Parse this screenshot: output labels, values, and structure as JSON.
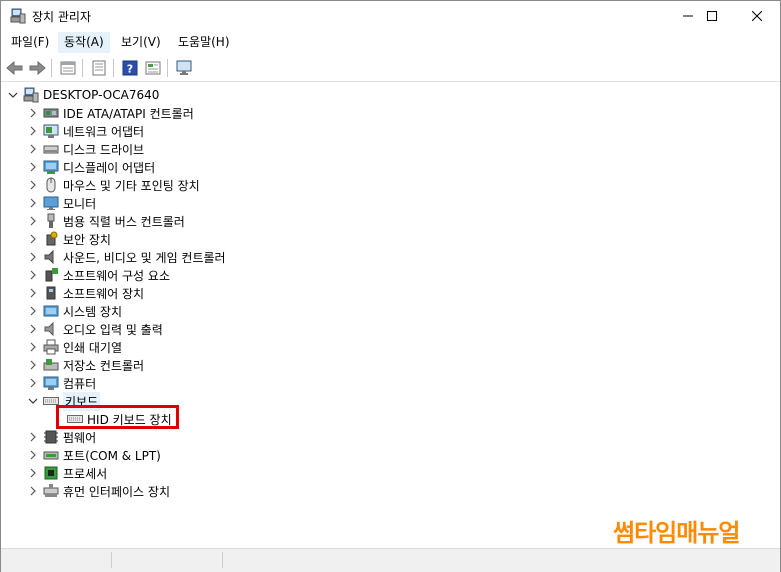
{
  "window": {
    "title": "장치 관리자",
    "icon": "device-manager-icon"
  },
  "menu": [
    {
      "label": "파일(F)"
    },
    {
      "label": "동작(A)"
    },
    {
      "label": "보기(V)"
    },
    {
      "label": "도움말(H)"
    }
  ],
  "toolbar": {
    "buttons": [
      "back-icon",
      "forward-icon",
      "properties-icon",
      "device-list-icon",
      "help-icon",
      "view-icon",
      "monitor-scan-icon"
    ]
  },
  "tree": {
    "root": {
      "label": "DESKTOP-OCA7640",
      "expanded": true
    },
    "items": [
      {
        "label": "IDE ATA/ATAPI 컨트롤러",
        "icon": "ide-controller-icon",
        "expanded": false
      },
      {
        "label": "네트워크 어댑터",
        "icon": "network-adapter-icon",
        "expanded": false
      },
      {
        "label": "디스크 드라이브",
        "icon": "disk-drive-icon",
        "expanded": false
      },
      {
        "label": "디스플레이 어댑터",
        "icon": "display-adapter-icon",
        "expanded": false
      },
      {
        "label": "마우스 및 기타 포인팅 장치",
        "icon": "mouse-icon",
        "expanded": false
      },
      {
        "label": "모니터",
        "icon": "monitor-icon",
        "expanded": false
      },
      {
        "label": "범용 직렬 버스 컨트롤러",
        "icon": "usb-icon",
        "expanded": false
      },
      {
        "label": "보안 장치",
        "icon": "security-device-icon",
        "expanded": false
      },
      {
        "label": "사운드, 비디오 및 게임 컨트롤러",
        "icon": "sound-icon",
        "expanded": false
      },
      {
        "label": "소프트웨어 구성 요소",
        "icon": "software-component-icon",
        "expanded": false
      },
      {
        "label": "소프트웨어 장치",
        "icon": "software-device-icon",
        "expanded": false
      },
      {
        "label": "시스템 장치",
        "icon": "system-device-icon",
        "expanded": false
      },
      {
        "label": "오디오 입력 및 출력",
        "icon": "audio-icon",
        "expanded": false
      },
      {
        "label": "인쇄 대기열",
        "icon": "printer-icon",
        "expanded": false
      },
      {
        "label": "저장소 컨트롤러",
        "icon": "storage-controller-icon",
        "expanded": false
      },
      {
        "label": "컴퓨터",
        "icon": "computer-icon",
        "expanded": false
      },
      {
        "label": "키보드",
        "icon": "keyboard-icon",
        "expanded": true,
        "selected": true
      },
      {
        "label": "HID 키보드 장치",
        "icon": "keyboard-icon",
        "child": true
      },
      {
        "label": "펌웨어",
        "icon": "firmware-icon",
        "expanded": false
      },
      {
        "label": "포트(COM & LPT)",
        "icon": "port-icon",
        "expanded": false
      },
      {
        "label": "프로세서",
        "icon": "processor-icon",
        "expanded": false
      },
      {
        "label": "휴먼 인터페이스 장치",
        "icon": "hid-icon",
        "expanded": false
      }
    ]
  },
  "watermark": "썸타임매뉴얼",
  "colors": {
    "highlight": "#e00000",
    "watermark": "#ff8a00",
    "selection": "#e5f1fb"
  }
}
